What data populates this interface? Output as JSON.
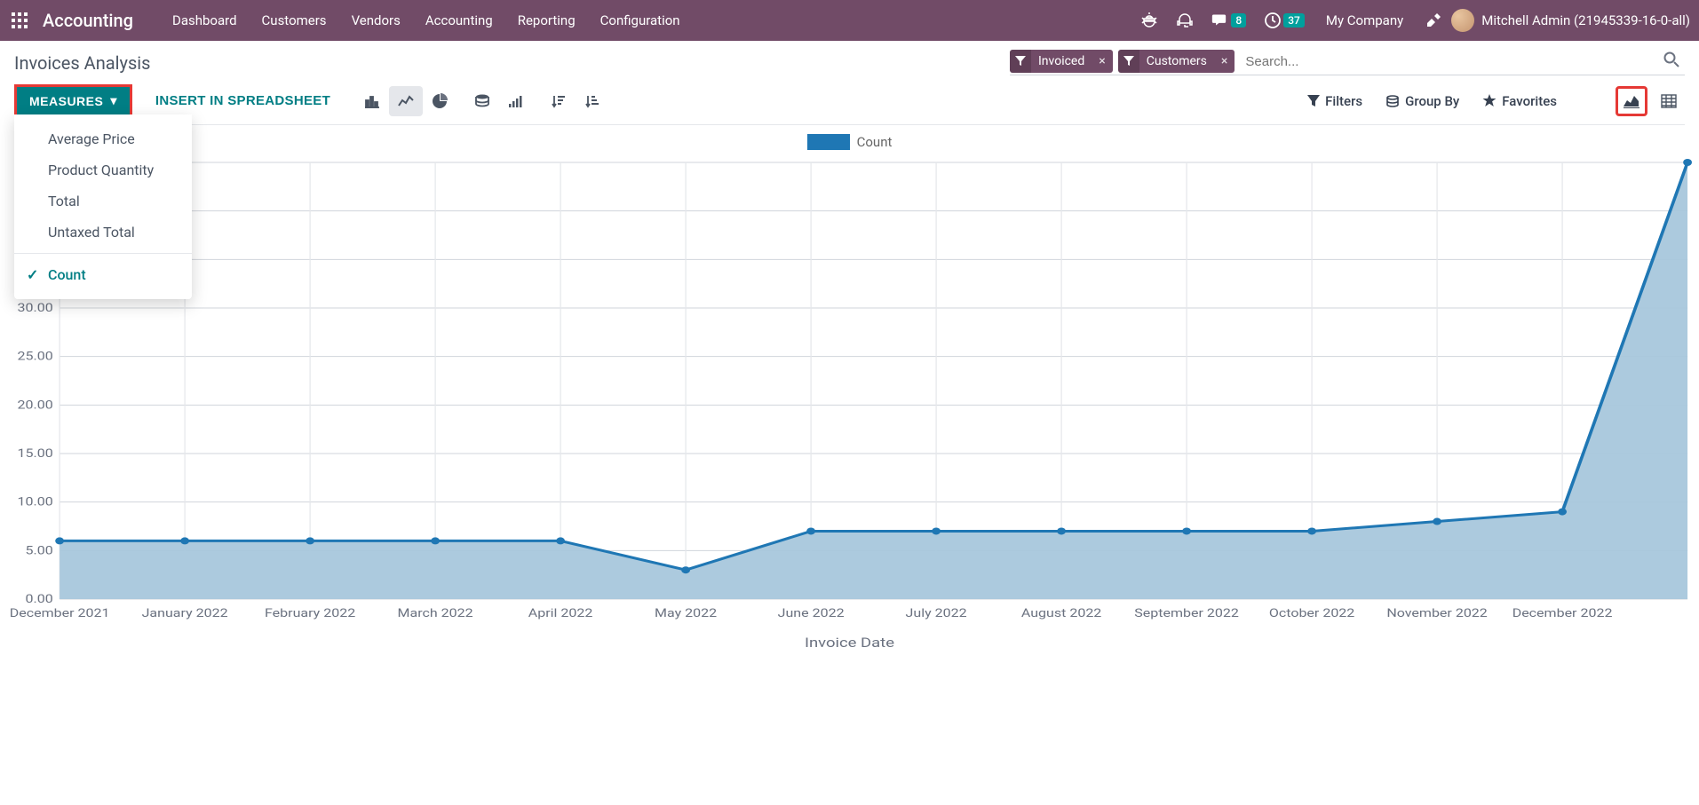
{
  "nav": {
    "brand": "Accounting",
    "items": [
      "Dashboard",
      "Customers",
      "Vendors",
      "Accounting",
      "Reporting",
      "Configuration"
    ],
    "messaging_badge": "8",
    "activities_badge": "37",
    "company": "My Company",
    "user": "Mitchell Admin (21945339-16-0-all)"
  },
  "page": {
    "title": "Invoices Analysis",
    "search_placeholder": "Search...",
    "facets": [
      {
        "label": "Invoiced"
      },
      {
        "label": "Customers"
      }
    ]
  },
  "toolbar": {
    "measures_label": "MEASURES",
    "insert_label": "INSERT IN SPREADSHEET",
    "filters_label": "Filters",
    "groupby_label": "Group By",
    "favorites_label": "Favorites"
  },
  "measures_menu": {
    "items": [
      {
        "label": "Average Price",
        "selected": false
      },
      {
        "label": "Product Quantity",
        "selected": false
      },
      {
        "label": "Total",
        "selected": false
      },
      {
        "label": "Untaxed Total",
        "selected": false
      }
    ],
    "count_label": "Count"
  },
  "chart": {
    "legend": "Count",
    "xlabel": "Invoice Date"
  },
  "chart_data": {
    "type": "area",
    "title": "",
    "xlabel": "Invoice Date",
    "ylabel": "",
    "ylim": [
      0,
      45
    ],
    "yticks": [
      0.0,
      5.0,
      10.0,
      15.0,
      20.0,
      25.0,
      30.0,
      35.0,
      40.0,
      45.0
    ],
    "categories": [
      "December 2021",
      "January 2022",
      "February 2022",
      "March 2022",
      "April 2022",
      "May 2022",
      "June 2022",
      "July 2022",
      "August 2022",
      "September 2022",
      "October 2022",
      "November 2022",
      "December 2022"
    ],
    "series": [
      {
        "name": "Count",
        "values": [
          6,
          6,
          6,
          6,
          6,
          3,
          7,
          7,
          7,
          7,
          7,
          8,
          9,
          45
        ]
      }
    ],
    "note": "First 13 values correspond to labeled categories Dec 2021–Dec 2022; final point (45) is an unlabeled trailing tick at the right edge."
  }
}
